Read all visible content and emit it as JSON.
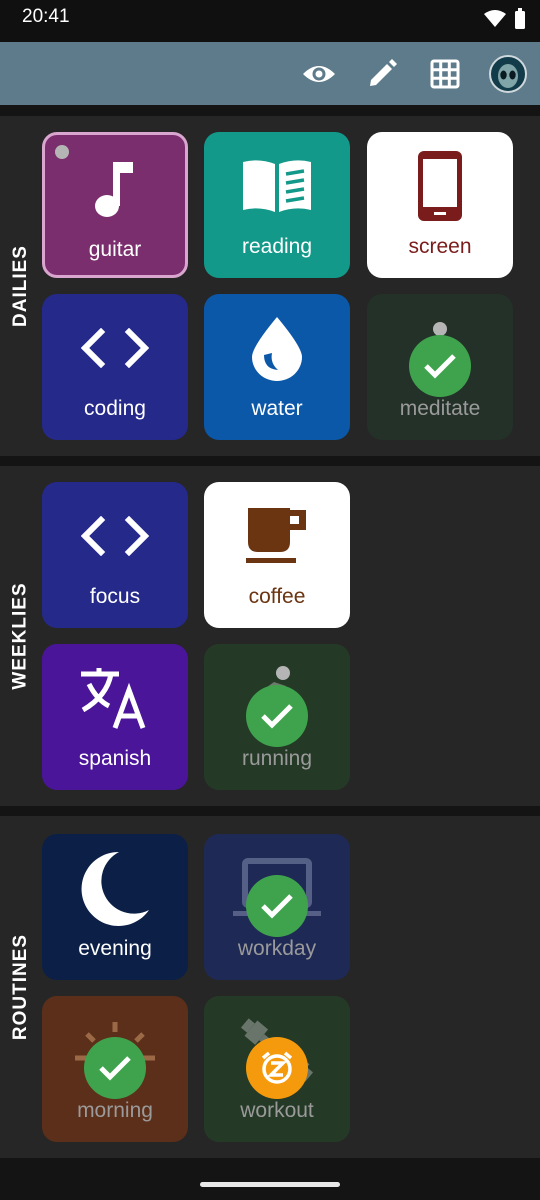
{
  "status": {
    "time": "20:41"
  },
  "toolbar": {
    "actions": [
      {
        "name": "view",
        "icon": "eye-icon"
      },
      {
        "name": "edit",
        "icon": "pencil-icon"
      },
      {
        "name": "grid",
        "icon": "grid-icon"
      },
      {
        "name": "profile",
        "icon": "alien-avatar-icon"
      }
    ]
  },
  "sections": [
    {
      "label": "DAILIES",
      "tiles": [
        {
          "label": "guitar",
          "icon": "music-note-icon",
          "color": "#7b2e6d",
          "text_color": "#ffffff",
          "done": false
        },
        {
          "label": "reading",
          "icon": "book-icon",
          "color": "#12998a",
          "text_color": "#ffffff",
          "done": false
        },
        {
          "label": "screen",
          "icon": "phone-icon",
          "color": "#ffffff",
          "text_color": "#7b1c1c",
          "done": false
        },
        {
          "label": "coding",
          "icon": "code-icon",
          "color": "#25298a",
          "text_color": "#ffffff",
          "done": false
        },
        {
          "label": "water",
          "icon": "water-drop-icon",
          "color": "#0b57a8",
          "text_color": "#ffffff",
          "done": false
        },
        {
          "label": "meditate",
          "icon": "meditate-icon",
          "color": "#233129",
          "text_color": "#9a9a9a",
          "done": true
        }
      ]
    },
    {
      "label": "WEEKLIES",
      "tiles": [
        {
          "label": "focus",
          "icon": "code-icon",
          "color": "#25298a",
          "text_color": "#ffffff",
          "done": false
        },
        {
          "label": "coffee",
          "icon": "coffee-icon",
          "color": "#ffffff",
          "text_color": "#6b3511",
          "done": false
        },
        {
          "label": "spanish",
          "icon": "translate-icon",
          "color": "#4b1599",
          "text_color": "#ffffff",
          "done": false
        },
        {
          "label": "running",
          "icon": "running-icon",
          "color": "#243a26",
          "text_color": "#9a9a9a",
          "done": true
        }
      ]
    },
    {
      "label": "ROUTINES",
      "tiles": [
        {
          "label": "evening",
          "icon": "moon-icon",
          "color": "#0b1f47",
          "text_color": "#ffffff",
          "done": false
        },
        {
          "label": "workday",
          "icon": "laptop-icon",
          "color": "#1e2a55",
          "text_color": "#9a9a9a",
          "done": true
        },
        {
          "label": "morning",
          "icon": "sunrise-icon",
          "color": "#5c2f1a",
          "text_color": "#9a9a9a",
          "done": true
        },
        {
          "label": "workout",
          "icon": "dumbbell-icon",
          "color": "#243a26",
          "text_color": "#9a9a9a",
          "done": true,
          "badge": "snooze-icon"
        }
      ]
    }
  ]
}
